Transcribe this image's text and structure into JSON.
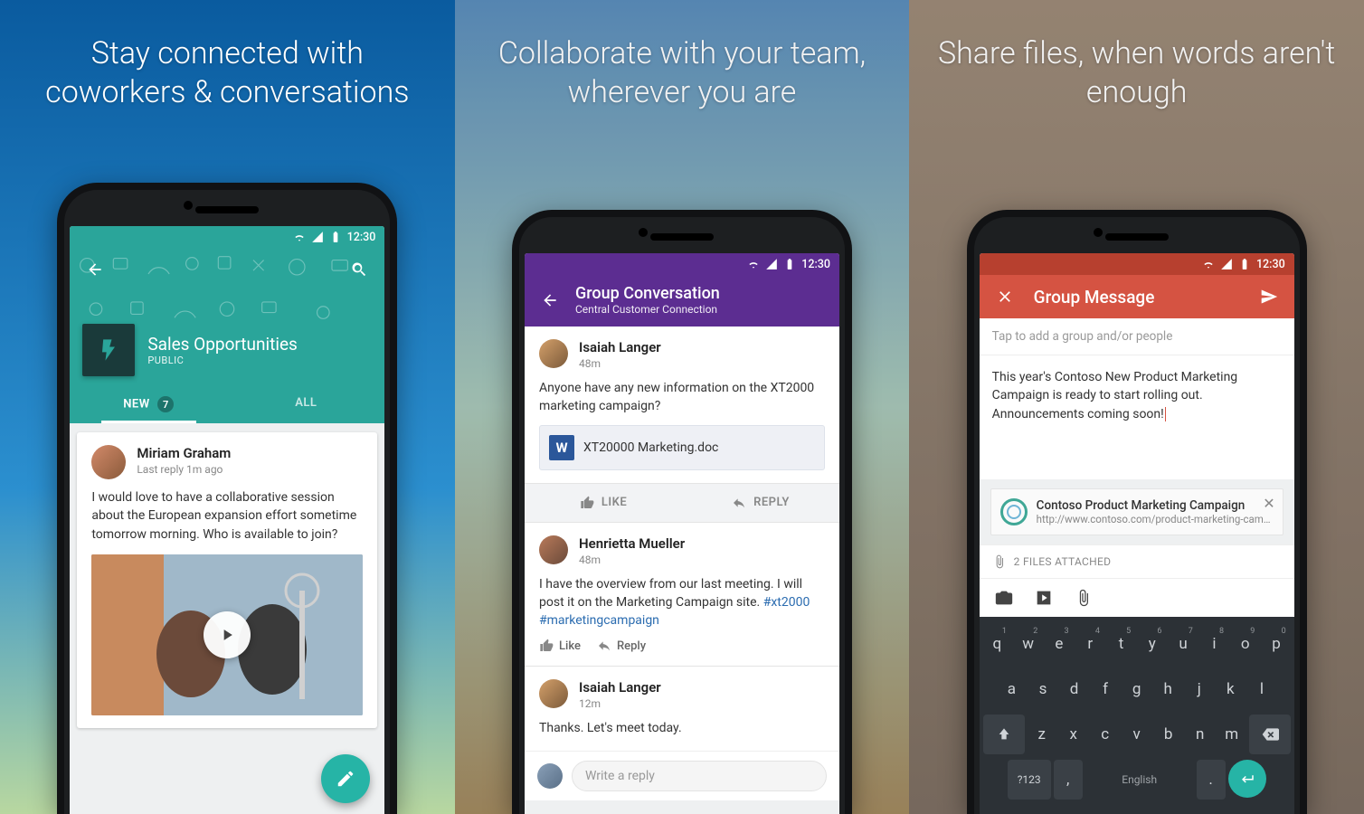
{
  "panels": {
    "p1": {
      "headline": "Stay connected with coworkers & conversations",
      "status_time": "12:30",
      "group": {
        "title": "Sales Opportunities",
        "visibility": "PUBLIC"
      },
      "tabs": {
        "new": "NEW",
        "new_count": "7",
        "all": "ALL"
      },
      "post": {
        "author": "Miriam Graham",
        "meta": "Last reply 1m ago",
        "body": "I would love to have a collaborative session about the European expansion effort sometime tomorrow morning. Who is available to join?"
      }
    },
    "p2": {
      "headline": "Collaborate with your team, wherever you are",
      "status_time": "12:30",
      "header": {
        "title": "Group Conversation",
        "subtitle": "Central Customer Connection"
      },
      "post1": {
        "author": "Isaiah Langer",
        "meta": "48m",
        "body": "Anyone have any new information on the XT2000 marketing campaign?",
        "attachment": "XT20000 Marketing.doc"
      },
      "actions": {
        "like": "LIKE",
        "reply": "REPLY"
      },
      "post2": {
        "author": "Henrietta Mueller",
        "meta": "48m",
        "body_plain": "I have the overview from our last meeting. I will post it on the Marketing Campaign site. ",
        "hash1": "#xt2000",
        "hash2": "#marketingcampaign",
        "like_label": "Like",
        "reply_label": "Reply"
      },
      "post3": {
        "author": "Isaiah Langer",
        "meta": "12m",
        "body": "Thanks. Let's meet today."
      },
      "reply_placeholder": "Write a reply"
    },
    "p3": {
      "headline": "Share files, when words aren't enough",
      "status_time": "12:30",
      "header": {
        "title": "Group Message"
      },
      "to_placeholder": "Tap to add a group and/or people",
      "compose_body": "This year's Contoso New Product Marketing Campaign is ready to start rolling out. Announcements coming soon!",
      "link": {
        "title": "Contoso Product Marketing Campaign",
        "url": "http://www.contoso.com/product-marketing-campaign"
      },
      "files_attached": "2 FILES ATTACHED",
      "keyboard": {
        "row1": [
          "q",
          "w",
          "e",
          "r",
          "t",
          "y",
          "u",
          "i",
          "o",
          "p"
        ],
        "row1_nums": [
          "1",
          "2",
          "3",
          "4",
          "5",
          "6",
          "7",
          "8",
          "9",
          "0"
        ],
        "row2": [
          "a",
          "s",
          "d",
          "f",
          "g",
          "h",
          "j",
          "k",
          "l"
        ],
        "row3": [
          "z",
          "x",
          "c",
          "v",
          "b",
          "n",
          "m"
        ],
        "sym": "?123",
        "comma": ",",
        "space": "English",
        "dot": "."
      }
    }
  }
}
